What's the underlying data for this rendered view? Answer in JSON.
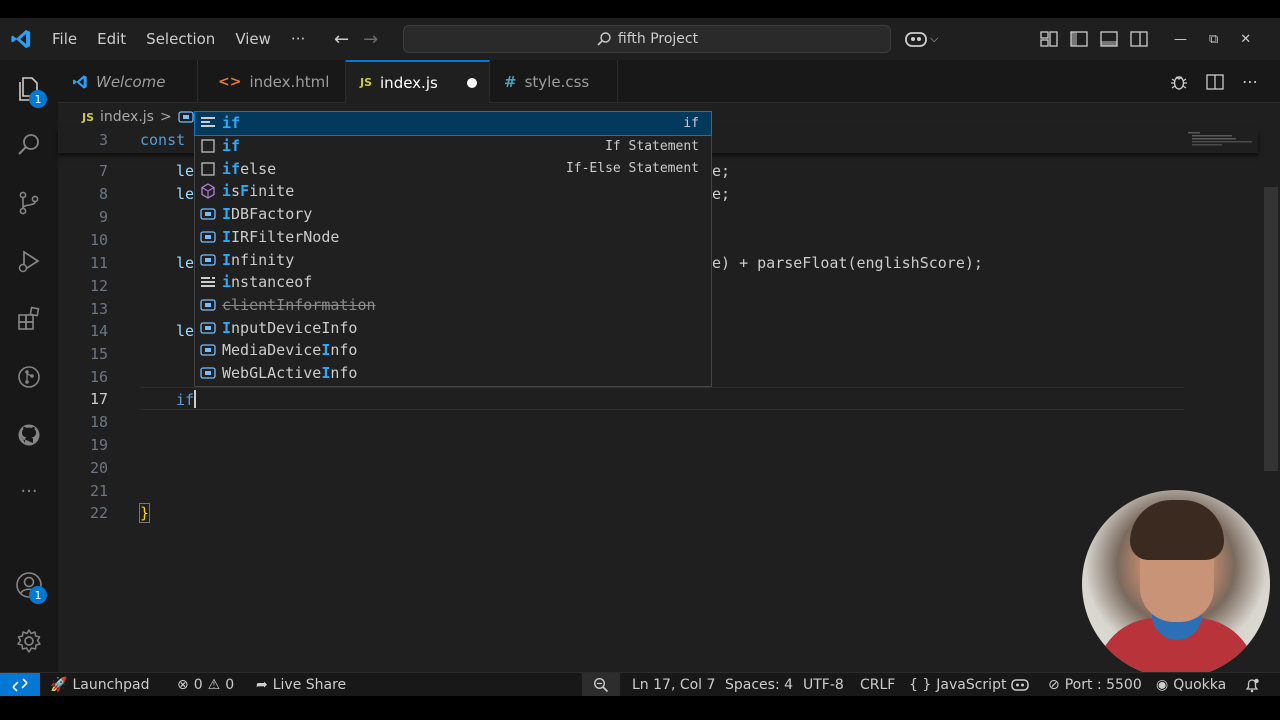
{
  "titlebar": {
    "menu": [
      "File",
      "Edit",
      "Selection",
      "View"
    ],
    "more": "···",
    "search": "fifth Project"
  },
  "activitybar": {
    "explorer_badge": "1",
    "accounts_badge": "1",
    "more": "···"
  },
  "tabs": [
    {
      "label": "Welcome",
      "icon": "vscode-logo-icon"
    },
    {
      "label": "index.html",
      "icon": "html-file-icon",
      "glyph": "<>"
    },
    {
      "label": "index.js",
      "icon": "js-file-icon",
      "glyph": "JS",
      "active": true,
      "modified": true
    },
    {
      "label": "style.css",
      "icon": "css-file-icon",
      "glyph": "#"
    }
  ],
  "breadcrumb": {
    "file_glyph": "JS",
    "file": "index.js",
    "sep": ">"
  },
  "editor": {
    "sticky": {
      "line": "3",
      "text": "const"
    },
    "lines": [
      {
        "n": "7",
        "left": "le",
        "right": "e;"
      },
      {
        "n": "8",
        "left": "le",
        "right": "e;"
      },
      {
        "n": "9"
      },
      {
        "n": "10"
      },
      {
        "n": "11",
        "left": "le",
        "right": "e) + parseFloat(englishScore);"
      },
      {
        "n": "12"
      },
      {
        "n": "13"
      },
      {
        "n": "14",
        "left": "le"
      },
      {
        "n": "15"
      },
      {
        "n": "16"
      },
      {
        "n": "17",
        "left": "if",
        "current": true
      },
      {
        "n": "18"
      },
      {
        "n": "19"
      },
      {
        "n": "20"
      },
      {
        "n": "21"
      },
      {
        "n": "22",
        "left": "}"
      }
    ]
  },
  "suggestions": [
    {
      "pre": "",
      "hl": "if",
      "post": "",
      "detail": "if",
      "icon": "snippet-icon",
      "selected": true
    },
    {
      "pre": "",
      "hl": "if",
      "post": "",
      "detail": "If Statement",
      "icon": "snippet-box-icon"
    },
    {
      "pre": "",
      "hl": "if",
      "post": "else",
      "detail": "If-Else Statement",
      "icon": "snippet-box-icon"
    },
    {
      "pre": "",
      "hl": "i",
      "post": "sFinite",
      "detail": "",
      "icon": "method-icon",
      "hl2": "F"
    },
    {
      "pre": "",
      "hl": "I",
      "post": "DBFactory",
      "detail": "",
      "icon": "variable-icon"
    },
    {
      "pre": "",
      "hl": "I",
      "post": "IRFilterNode",
      "detail": "",
      "icon": "variable-icon"
    },
    {
      "pre": "",
      "hl": "I",
      "post": "nfinity",
      "detail": "",
      "icon": "variable-icon"
    },
    {
      "pre": "",
      "hl": "i",
      "post": "nstanceof",
      "detail": "",
      "icon": "keyword-icon"
    },
    {
      "pre": "",
      "hl": "",
      "post": "clientInformation",
      "detail": "",
      "icon": "variable-icon",
      "strike": true
    },
    {
      "pre": "",
      "hl": "I",
      "post": "nputDeviceInfo",
      "detail": "",
      "icon": "variable-icon"
    },
    {
      "pre": "MediaDevice",
      "hl": "I",
      "post": "nfo",
      "detail": "",
      "icon": "variable-icon"
    },
    {
      "pre": "WebGLActive",
      "hl": "I",
      "post": "nfo",
      "detail": "",
      "icon": "variable-icon"
    }
  ],
  "statusbar": {
    "launchpad": "Launchpad",
    "errors": "0",
    "warnings": "0",
    "liveshare": "Live Share",
    "position": "Ln 17, Col 7",
    "spaces": "Spaces: 4",
    "encoding": "UTF-8",
    "eol": "CRLF",
    "language_glyph": "{ }",
    "language": "JavaScript",
    "port": "Port : 5500",
    "quokka": "Quokka"
  },
  "colors": {
    "accent": "#0078d4",
    "editor_bg": "#1f1f1f",
    "match_highlight": "#2aaaff",
    "keyword": "#569cd6"
  }
}
